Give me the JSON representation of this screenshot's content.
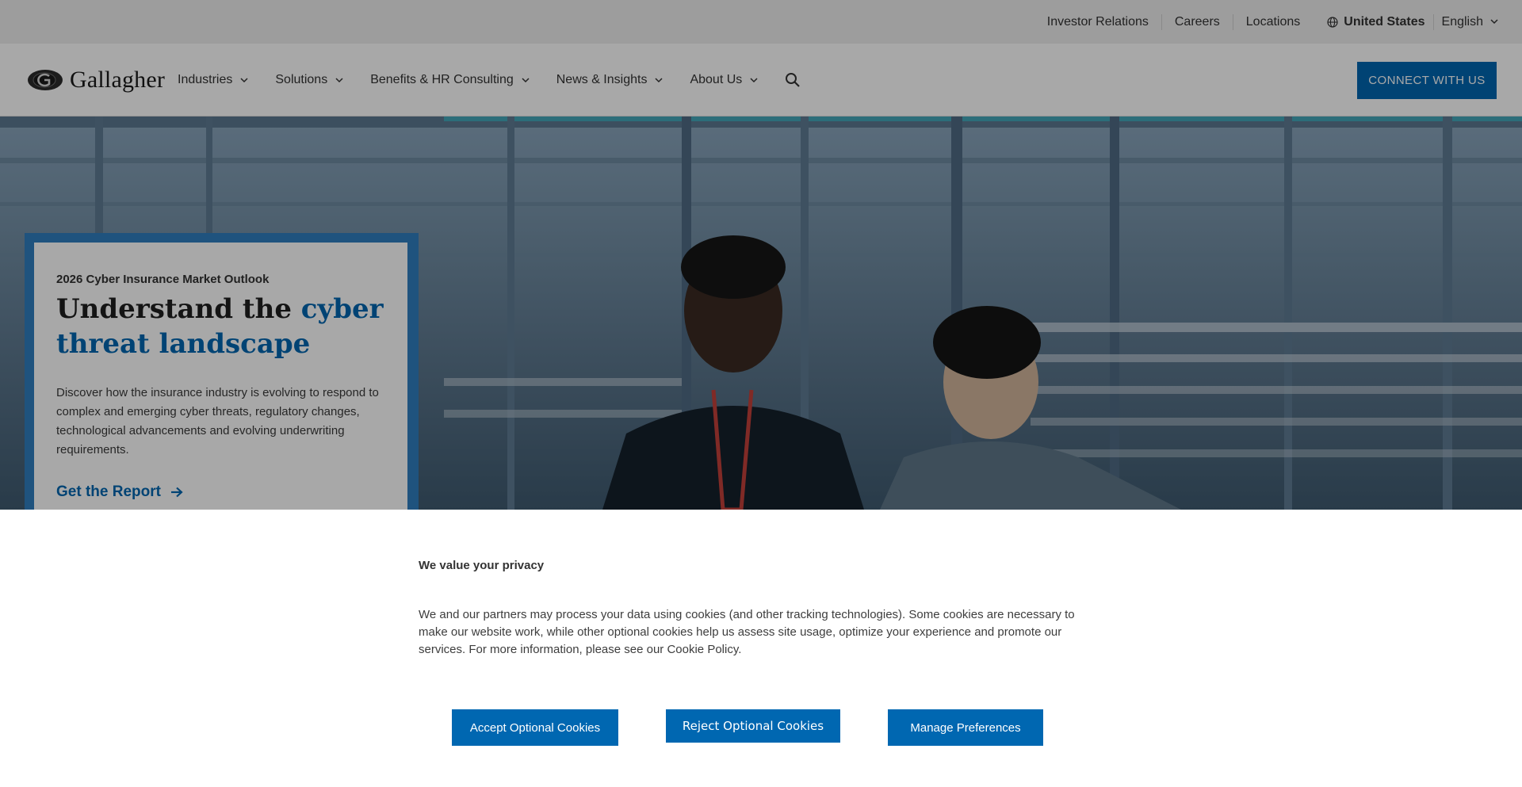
{
  "utility": {
    "links": [
      "Investor Relations",
      "Careers",
      "Locations"
    ],
    "country": "United States",
    "language": "English"
  },
  "nav": {
    "logo_text": "Gallagher",
    "items": [
      "Industries",
      "Solutions",
      "Benefits & HR Consulting",
      "News & Insights",
      "About Us"
    ],
    "connect_label": "CONNECT WITH US"
  },
  "hero": {
    "eyebrow": "2026 Cyber Insurance Market Outlook",
    "title_prefix": "Understand the ",
    "title_accent": "cyber threat landscape",
    "body": "Discover how the insurance industry is evolving to respond to complex and emerging cyber threats, regulatory changes, technological advancements and evolving underwriting requirements.",
    "cta": "Get the Report"
  },
  "cookie": {
    "title": "We value your privacy",
    "text": "We and our partners may process your data using cookies (and other tracking technologies). Some cookies are necessary to make our website work, while other optional cookies help us assess site usage, optimize your experience and promote our services. For more information, please see our Cookie Policy.",
    "accept_label": "Accept Optional Cookies",
    "reject_label": "Reject Optional Cookies",
    "manage_label": "Manage Preferences"
  },
  "colors": {
    "brand_blue": "#0067b1",
    "utility_bg": "#eeeeef",
    "text_dark": "#2f2f2f"
  },
  "icons": [
    "globe-icon",
    "chevron-down-icon",
    "search-icon",
    "arrow-right-icon",
    "gallagher-logo-icon"
  ]
}
